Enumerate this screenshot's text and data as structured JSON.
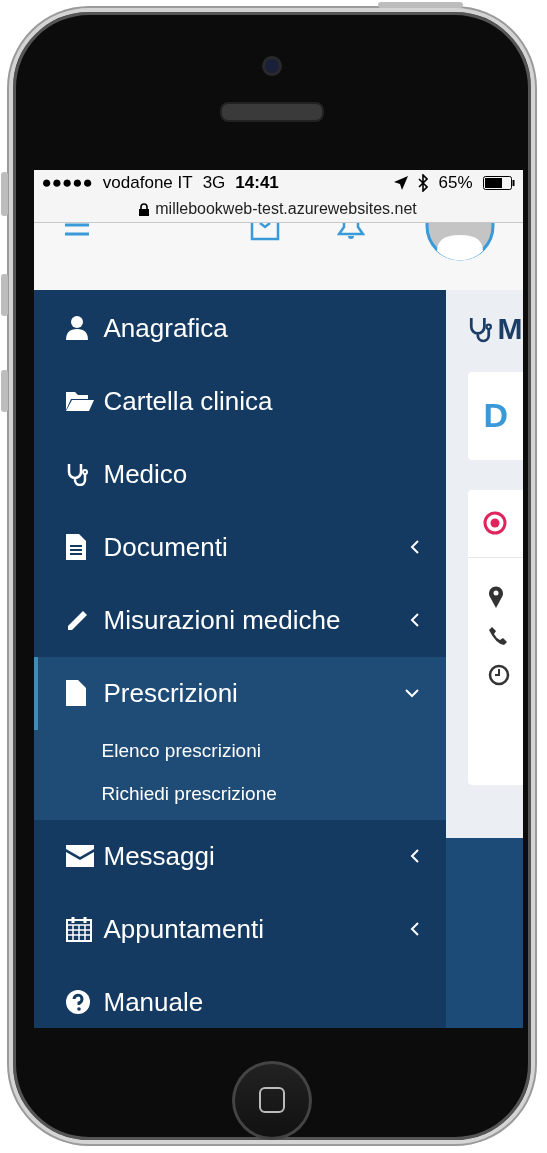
{
  "status_bar": {
    "signal": "●●●●●",
    "carrier": "vodafone IT",
    "network": "3G",
    "time": "14:41",
    "battery": "65%"
  },
  "address_bar": {
    "url": "millebookweb-test.azurewebsites.net"
  },
  "sidebar": {
    "items": [
      {
        "label": "Anagrafica",
        "kind": "plain",
        "selected": false
      },
      {
        "label": "Cartella clinica",
        "kind": "plain",
        "selected": false
      },
      {
        "label": "Medico",
        "kind": "plain",
        "selected": false
      },
      {
        "label": "Documenti",
        "kind": "submenu",
        "expanded": false,
        "selected": false
      },
      {
        "label": "Misurazioni mediche",
        "kind": "submenu",
        "expanded": false,
        "selected": false
      },
      {
        "label": "Prescrizioni",
        "kind": "submenu",
        "expanded": true,
        "selected": true,
        "children": [
          {
            "label": "Elenco prescrizioni"
          },
          {
            "label": "Richiedi prescrizione"
          }
        ]
      },
      {
        "label": "Messaggi",
        "kind": "submenu",
        "expanded": false,
        "selected": false
      },
      {
        "label": "Appuntamenti",
        "kind": "submenu",
        "expanded": false,
        "selected": false
      },
      {
        "label": "Manuale",
        "kind": "plain",
        "selected": false
      }
    ]
  },
  "main": {
    "heading": "M",
    "card_title": "D"
  }
}
